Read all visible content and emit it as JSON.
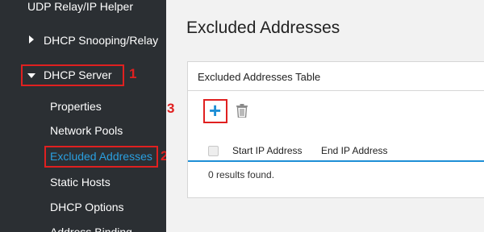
{
  "sidebar": {
    "top_item": "UDP Relay/IP Helper",
    "snooping": "DHCP Snooping/Relay",
    "server": "DHCP Server",
    "sub_items": [
      "Properties",
      "Network Pools",
      "Excluded Addresses",
      "Static Hosts",
      "DHCP Options",
      "Address Binding"
    ]
  },
  "callouts": {
    "one": "1",
    "two": "2",
    "three": "3"
  },
  "main": {
    "title": "Excluded Addresses",
    "panel_title": "Excluded Addresses Table",
    "add_icon": "+",
    "columns": [
      "Start IP Address",
      "End IP Address"
    ],
    "results": "0 results found."
  },
  "colors": {
    "accent": "#1e8fd6",
    "highlight": "#e02020",
    "sidebar_bg": "#2b2f33",
    "active_text": "#2a9fdf"
  }
}
